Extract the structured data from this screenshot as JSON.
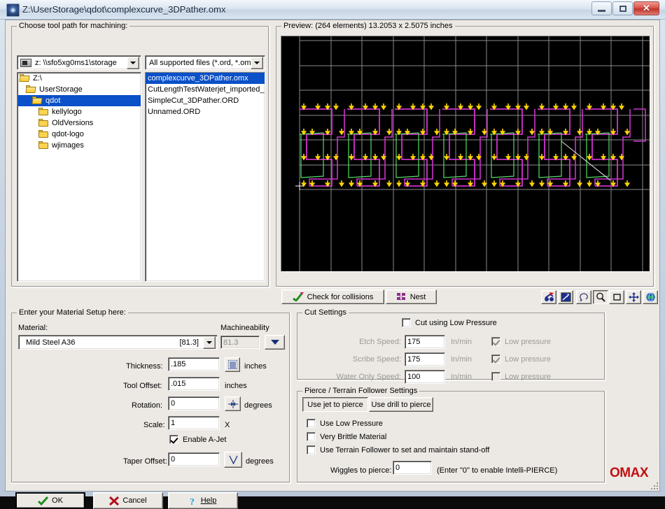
{
  "window": {
    "title": "Z:\\UserStorage\\qdot\\complexcurve_3DPather.omx",
    "icon": "omax-app-icon",
    "minimize_label": "",
    "maximize_label": "",
    "close_label": "✕"
  },
  "toolpath_group": {
    "title": "Choose tool path for machining:",
    "drive_combo": {
      "value": "z: \\\\sfo5xg0ms1\\storage",
      "icon": "drive-icon"
    },
    "filter_combo": {
      "value": "All supported files (*.ord, *.omx)"
    },
    "tree": [
      {
        "label": "Z:\\",
        "indent": 0,
        "selected": false,
        "open": true
      },
      {
        "label": "UserStorage",
        "indent": 1,
        "selected": false,
        "open": true
      },
      {
        "label": "qdot",
        "indent": 2,
        "selected": true,
        "open": true
      },
      {
        "label": "kellylogo",
        "indent": 3,
        "selected": false,
        "open": false
      },
      {
        "label": "OldVersions",
        "indent": 3,
        "selected": false,
        "open": false
      },
      {
        "label": "qdot-logo",
        "indent": 3,
        "selected": false,
        "open": false
      },
      {
        "label": "wjimages",
        "indent": 3,
        "selected": false,
        "open": false
      }
    ],
    "files": [
      {
        "label": "complexcurve_3DPather.omx",
        "selected": true
      },
      {
        "label": "CutLengthTestWaterjet_imported_ai.",
        "selected": false
      },
      {
        "label": "SimpleCut_3DPather.ORD",
        "selected": false
      },
      {
        "label": "Unnamed.ORD",
        "selected": false
      }
    ]
  },
  "preview": {
    "title": "Preview: (264 elements) 13.2053 x 2.5075 inches",
    "element_count": "264",
    "width_in": "13.2053",
    "height_in": "2.5075",
    "check_collisions_label": "Check for collisions",
    "nest_label": "Nest",
    "tools": [
      {
        "name": "cleanup-icon",
        "pressed": false
      },
      {
        "name": "quality-icon",
        "pressed": false
      },
      {
        "name": "lasso-select-icon",
        "pressed": false
      },
      {
        "name": "zoom-icon",
        "pressed": true
      },
      {
        "name": "zoom-window-icon",
        "pressed": false
      },
      {
        "name": "pan-icon",
        "pressed": false
      },
      {
        "name": "globe-view-icon",
        "pressed": false
      }
    ],
    "canvas": {
      "background": "#000000",
      "grid_color": "#8a8a8a",
      "cut_path_color": "#cc33cc",
      "traverse_color": "#55dd66",
      "pierce_marker_color": "#ffd400",
      "origin_marker_color": "#ffffff"
    }
  },
  "material_group": {
    "title": "Enter your Material Setup here:",
    "material_label": "Material:",
    "material_value": "Mild Steel A36",
    "material_bracket": "[81.3]",
    "machineability_label": "Machineability",
    "machineability_value": "81.3",
    "thickness_label": "Thickness:",
    "thickness_value": ".185",
    "thickness_units": "inches",
    "thickness_button_icon": "material-library-icon",
    "tool_offset_label": "Tool Offset:",
    "tool_offset_value": ".015",
    "tool_offset_units": "inches",
    "rotation_label": "Rotation:",
    "rotation_value": "0",
    "rotation_units": "degrees",
    "rotation_button_icon": "align-rotate-icon",
    "scale_label": "Scale:",
    "scale_value": "1",
    "scale_units": "X",
    "enable_ajet_label": "Enable A-Jet",
    "enable_ajet_checked": true,
    "taper_offset_label": "Taper Offset:",
    "taper_offset_value": "0",
    "taper_offset_units": "degrees",
    "taper_button_icon": "taper-v-icon"
  },
  "cut_settings": {
    "title": "Cut Settings",
    "cut_low_pressure_label": "Cut using Low Pressure",
    "cut_low_pressure_checked": false,
    "rows": [
      {
        "label": "Etch Speed:",
        "value": "175",
        "units": "In/min",
        "lp_label": "Low pressure",
        "lp_checked": true
      },
      {
        "label": "Scribe Speed:",
        "value": "175",
        "units": "In/min",
        "lp_label": "Low pressure",
        "lp_checked": true
      },
      {
        "label": "Water Only Speed:",
        "value": "100",
        "units": "In/min",
        "lp_label": "Low pressure",
        "lp_checked": false
      }
    ]
  },
  "pierce_settings": {
    "title": "Pierce / Terrain Follower Settings",
    "use_jet_label": "Use jet to pierce",
    "use_drill_label": "Use drill to pierce",
    "checks": [
      {
        "label": "Use Low Pressure",
        "checked": false
      },
      {
        "label": "Very Brittle Material",
        "checked": false
      },
      {
        "label": "Use Terrain Follower to set and maintain stand-off",
        "checked": false
      }
    ],
    "wiggles_label": "Wiggles to pierce:",
    "wiggles_value": "0",
    "wiggles_hint": "(Enter \"0\" to enable Intelli-PIERCE)"
  },
  "footer": {
    "ok_label": "OK",
    "cancel_label": "Cancel",
    "help_label": "Help",
    "brand": "OMAX",
    "brand_color": "#c20f12"
  }
}
